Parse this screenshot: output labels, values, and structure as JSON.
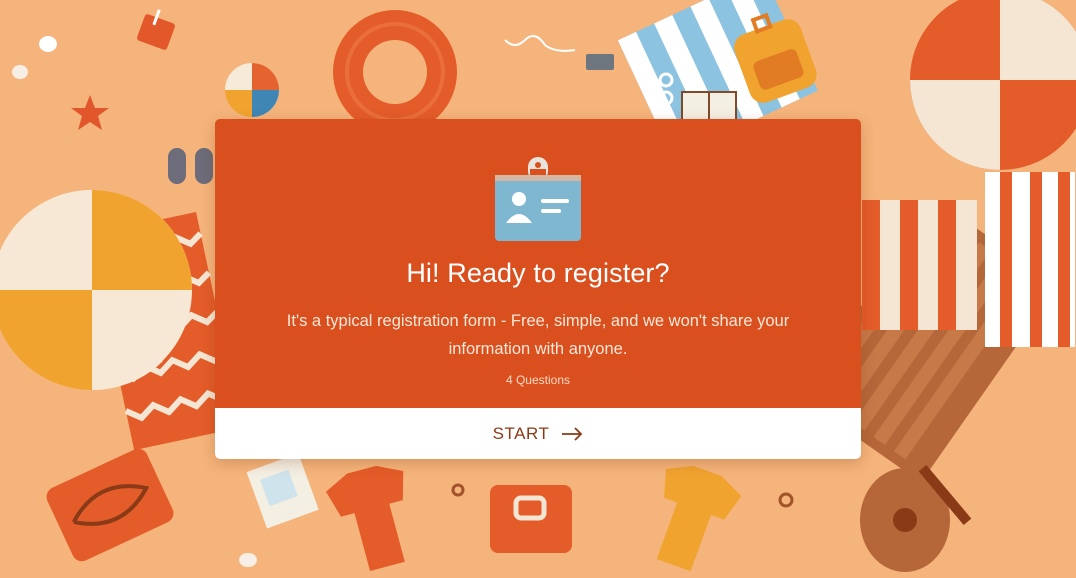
{
  "colors": {
    "background": "#f4b47b",
    "card": "#d94f1e",
    "button_bg": "#ffffff",
    "button_text": "#8a3a16"
  },
  "intro": {
    "icon": "id-badge-icon",
    "title": "Hi! Ready to register?",
    "description": "It's a typical registration form - Free, simple, and we won't share your information with anyone.",
    "question_count": "4 Questions",
    "start_label": "START",
    "start_icon": "arrow-right-icon"
  }
}
